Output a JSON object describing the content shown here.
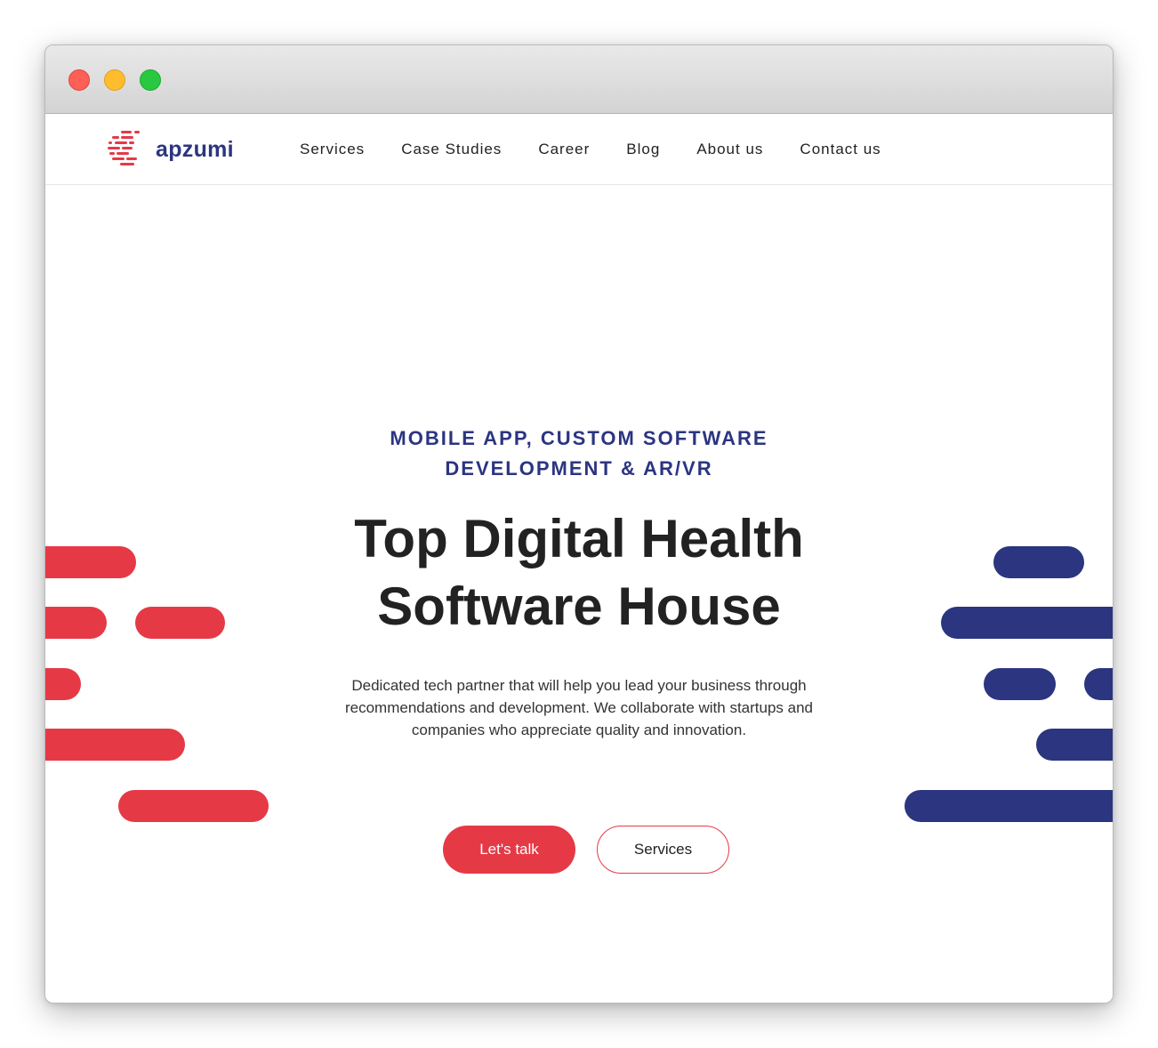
{
  "brand": {
    "name": "apzumi",
    "accent_red": "#e63946",
    "accent_blue": "#2b3580"
  },
  "nav": {
    "items": [
      {
        "label": "Services"
      },
      {
        "label": "Case Studies"
      },
      {
        "label": "Career"
      },
      {
        "label": "Blog"
      },
      {
        "label": "About us"
      },
      {
        "label": "Contact us"
      }
    ]
  },
  "hero": {
    "kicker_line1": "MOBILE APP, CUSTOM SOFTWARE",
    "kicker_line2": "DEVELOPMENT & AR/VR",
    "title_line1": "Top Digital Health",
    "title_line2": "Software House",
    "desc_line1": "Dedicated tech partner that will help you lead your business through",
    "desc_line2": "recommendations and development. We collaborate with startups and",
    "desc_line3": "companies who appreciate quality and innovation.",
    "primary_button": "Let's talk",
    "secondary_button": "Services"
  }
}
